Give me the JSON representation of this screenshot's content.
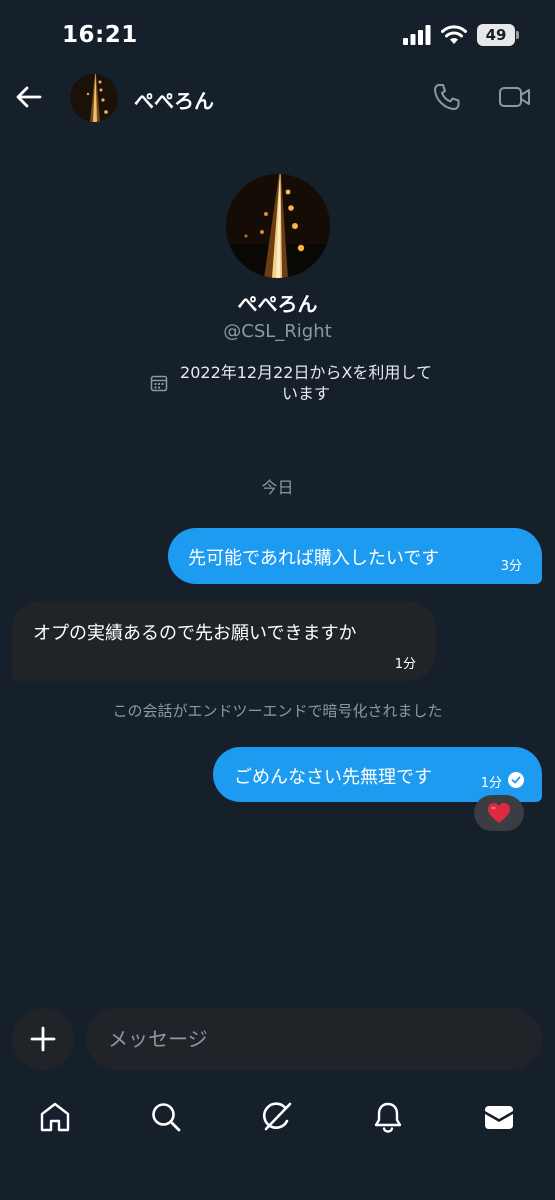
{
  "status_bar": {
    "time": "16:21",
    "battery": "49"
  },
  "header": {
    "name": "ぺぺろん",
    "icons": [
      "back-arrow-icon",
      "phone-icon",
      "video-icon"
    ]
  },
  "profile": {
    "name": "ぺぺろん",
    "handle": "@CSL_Right",
    "joined": "2022年12月22日からXを利用しています"
  },
  "conversation": {
    "day_separator": "今日",
    "messages": [
      {
        "direction": "sent",
        "text": "先可能であれば購入したいです",
        "time": "3分"
      },
      {
        "direction": "received",
        "text": "オプの実績あるので先お願いできますか",
        "time": "1分"
      },
      {
        "direction": "sent",
        "text": "ごめんなさい先無理です",
        "time": "1分",
        "read": true,
        "reaction": "❤️"
      }
    ],
    "encryption_notice": "この会話がエンドツーエンドで暗号化されました"
  },
  "composer": {
    "placeholder": "メッセージ"
  },
  "nav": {
    "items": [
      "home-icon",
      "search-icon",
      "grok-icon",
      "notifications-icon",
      "messages-icon"
    ]
  },
  "colors": {
    "background": "#15202b",
    "accent": "#1d9bf0",
    "bubble_received": "#202327",
    "muted": "#8b98a5"
  }
}
